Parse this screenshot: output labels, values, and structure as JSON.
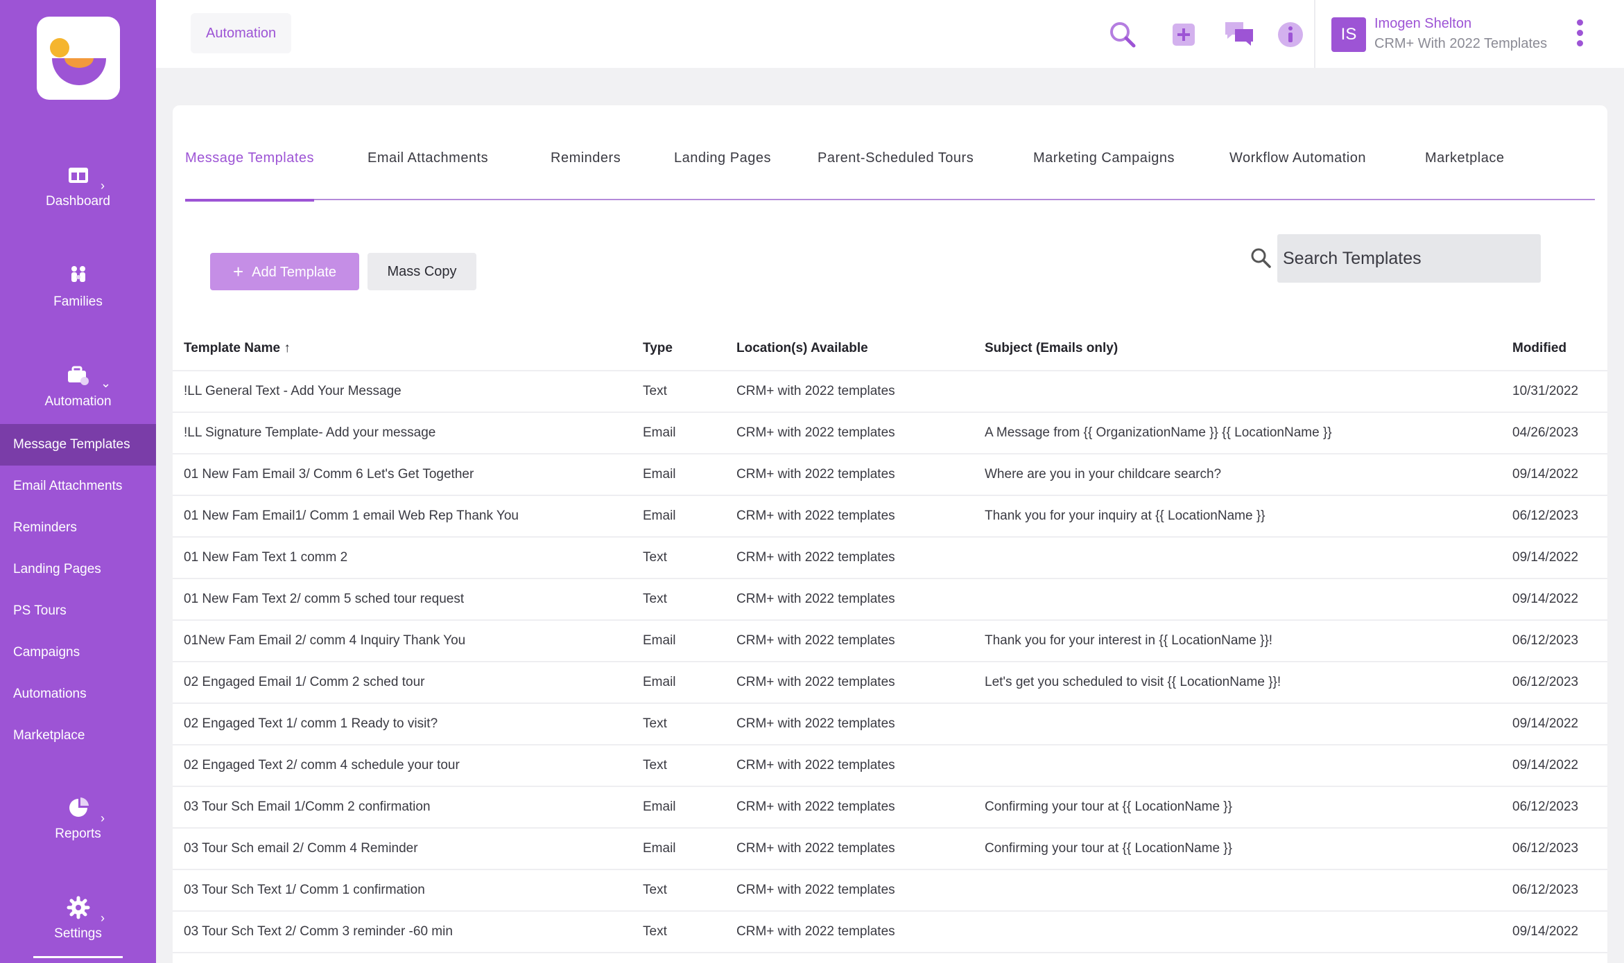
{
  "sidebar": {
    "nav": [
      {
        "label": "Dashboard",
        "icon": "dashboard-icon",
        "chevron": "›"
      },
      {
        "label": "Families",
        "icon": "families-icon"
      },
      {
        "label": "Automation",
        "icon": "automation-icon",
        "chevron": "⌄"
      }
    ],
    "sub_items": [
      "Message Templates",
      "Email Attachments",
      "Reminders",
      "Landing Pages",
      "PS Tours",
      "Campaigns",
      "Automations",
      "Marketplace"
    ],
    "bottom_nav": [
      {
        "label": "Reports",
        "icon": "reports-icon",
        "chevron": "›"
      },
      {
        "label": "Settings",
        "icon": "settings-icon",
        "chevron": "›"
      }
    ]
  },
  "topbar": {
    "breadcrumb": "Automation",
    "user": {
      "initials": "IS",
      "name": "Imogen Shelton",
      "org": "CRM+ With 2022 Templates"
    }
  },
  "tabs": [
    "Message Templates",
    "Email Attachments",
    "Reminders",
    "Landing Pages",
    "Parent-Scheduled Tours",
    "Marketing Campaigns",
    "Workflow Automation",
    "Marketplace"
  ],
  "toolbar": {
    "add_label": "Add Template",
    "copy_label": "Mass Copy",
    "search_placeholder": "Search Templates"
  },
  "table": {
    "headers": [
      "Template Name",
      "Type",
      "Location(s) Available",
      "Subject (Emails only)",
      "Modified"
    ],
    "sort_arrow": "↑",
    "rows": [
      [
        "!LL General Text - Add Your Message",
        "Text",
        "CRM+ with 2022 templates",
        "",
        "10/31/2022"
      ],
      [
        "!LL Signature Template- Add your message",
        "Email",
        "CRM+ with 2022 templates",
        "A Message from {{ OrganizationName }} {{ LocationName }}",
        "04/26/2023"
      ],
      [
        "01 New Fam Email 3/ Comm 6 Let's Get Together",
        "Email",
        "CRM+ with 2022 templates",
        "Where are you in your childcare search?",
        "09/14/2022"
      ],
      [
        "01 New Fam Email1/ Comm 1 email Web Rep Thank You",
        "Email",
        "CRM+ with 2022 templates",
        "Thank you for your inquiry at {{ LocationName }}",
        "06/12/2023"
      ],
      [
        "01 New Fam Text 1 comm 2",
        "Text",
        "CRM+ with 2022 templates",
        "",
        "09/14/2022"
      ],
      [
        "01 New Fam Text 2/ comm 5 sched tour request",
        "Text",
        "CRM+ with 2022 templates",
        "",
        "09/14/2022"
      ],
      [
        "01New Fam Email 2/ comm 4 Inquiry Thank You",
        "Email",
        "CRM+ with 2022 templates",
        "Thank you for your interest in {{ LocationName }}!",
        "06/12/2023"
      ],
      [
        "02 Engaged Email 1/ Comm 2 sched tour",
        "Email",
        "CRM+ with 2022 templates",
        "Let's get you scheduled to visit {{ LocationName }}!",
        "06/12/2023"
      ],
      [
        "02 Engaged Text 1/ comm 1 Ready to visit?",
        "Text",
        "CRM+ with 2022 templates",
        "",
        "09/14/2022"
      ],
      [
        "02 Engaged Text 2/ comm 4 schedule your tour",
        "Text",
        "CRM+ with 2022 templates",
        "",
        "09/14/2022"
      ],
      [
        "03 Tour Sch Email 1/Comm 2 confirmation",
        "Email",
        "CRM+ with 2022 templates",
        "Confirming your tour at {{ LocationName }}",
        "06/12/2023"
      ],
      [
        "03 Tour Sch email 2/ Comm 4 Reminder",
        "Email",
        "CRM+ with 2022 templates",
        "Confirming your tour at {{ LocationName }}",
        "06/12/2023"
      ],
      [
        "03 Tour Sch Text 1/ Comm 1 confirmation",
        "Text",
        "CRM+ with 2022 templates",
        "",
        "06/12/2023"
      ],
      [
        "03 Tour Sch Text 2/ Comm 3 reminder -60 min",
        "Text",
        "CRM+ with 2022 templates",
        "",
        "09/14/2022"
      ]
    ]
  },
  "colors": {
    "brand": "#9d54d5",
    "brand_dark": "#7a3da8",
    "button_light": "#c58ee6",
    "logo_yellow": "#f5b52e",
    "logo_orange": "#f29a3c"
  },
  "icons": [
    "search-icon",
    "add-icon",
    "chat-icon",
    "info-icon",
    "kebab-menu-icon",
    "sort-up-icon"
  ]
}
